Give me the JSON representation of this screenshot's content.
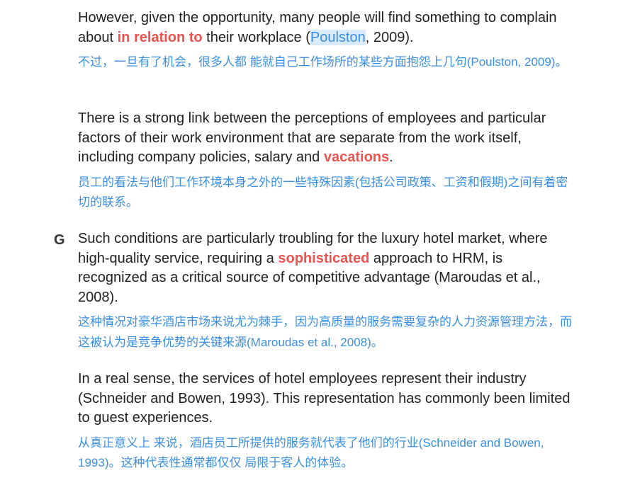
{
  "paragraphs": [
    {
      "marker": "",
      "en": {
        "before": "However, given the opportunity, many people will find something to complain about ",
        "keyword": "in relation to",
        "mid": " their workplace (",
        "selected": "Poulston",
        "after": ", 2009)."
      },
      "zh": "不过，一旦有了机会，很多人都 能就自己工作场所的某些方面抱怨上几句(Poulston, 2009)。"
    },
    {
      "marker": "",
      "en": {
        "before": "There is a strong link between the perceptions of employees and particular factors of their work environment that are separate from the work itself, including company policies, salary and ",
        "keyword": "vacations",
        "after": "."
      },
      "zh": "员工的看法与他们工作环境本身之外的一些特殊因素(包括公司政策、工资和假期)之间有着密切的联系。"
    },
    {
      "marker": "G",
      "en": {
        "before": "Such conditions are particularly troubling for the luxury hotel market, where high-quality service, requiring a ",
        "keyword": "sophisticated",
        "after": " approach to HRM, is recognized as a critical source of competitive advantage (Maroudas et al., 2008)."
      },
      "zh": "这种情况对豪华酒店市场来说尤为棘手，因为高质量的服务需要复杂的人力资源管理方法，而这被认为是竞争优势的关键来源(Maroudas et al., 2008)。"
    },
    {
      "marker": "",
      "en": {
        "text": "In a real sense, the services of hotel employees represent their industry (Schneider and Bowen, 1993). This representation has commonly been limited to guest experiences."
      },
      "zh": "从真正意义上 来说，酒店员工所提供的服务就代表了他们的行业(Schneider and Bowen, 1993)。这种代表性通常都仅仅 局限于客人的体验。"
    }
  ],
  "colors": {
    "english_text": "#222222",
    "translation_text": "#3b8fe0",
    "keyword": "#ef5350",
    "selection_background": "#d9eafb",
    "marker": "#333333"
  }
}
